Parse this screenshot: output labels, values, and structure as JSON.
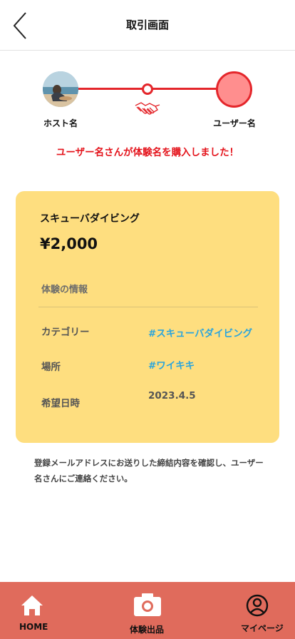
{
  "header": {
    "title": "取引画面",
    "back_icon": "chevron-left-icon"
  },
  "progress": {
    "host_name": "ホスト名",
    "user_name": "ユーザー名",
    "accent_color": "#e4262b",
    "user_avatar_color": "#ff8e8e",
    "middle_icon": "handshake-icon"
  },
  "notice": "ユーザー名さんが体験名を購入しました！",
  "card": {
    "background": "#fede7f",
    "title": "スキューバダイビング",
    "price": "¥2,000",
    "section_label": "体験の情報",
    "category_label": "カテゴリー",
    "category_value": "#スキューバダイビング",
    "location_label": "場所",
    "location_value": "#ワイキキ",
    "date_label": "希望日時",
    "date_value": "2023.4.5"
  },
  "note": "登録メールアドレスにお送りした締結内容を確認し、ユーザー名さんにご連絡ください。",
  "tabbar": {
    "background": "#e06b5c",
    "tabs": [
      {
        "label": "HOME",
        "icon": "home-icon"
      },
      {
        "label": "体験出品",
        "icon": "camera-icon"
      },
      {
        "label": "マイページ",
        "icon": "user-circle-icon"
      }
    ]
  }
}
